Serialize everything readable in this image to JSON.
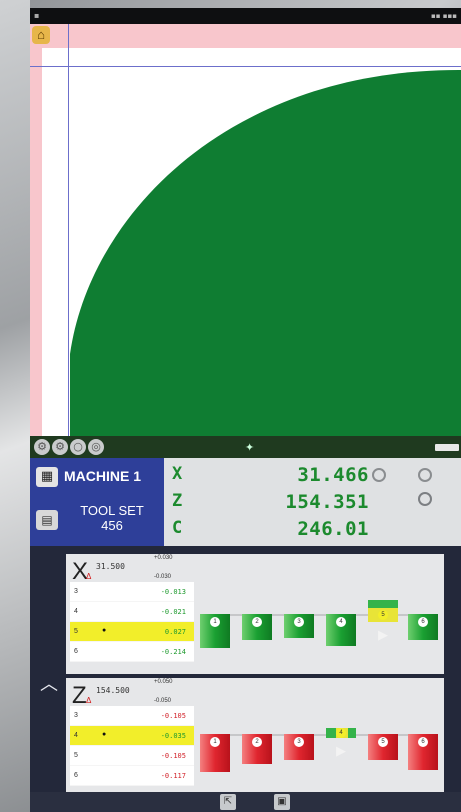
{
  "colors": {
    "canvas_margin": "#f8c6cc",
    "part_fill": "#0f7d32",
    "readout_green": "#1c8a2e",
    "panel_blue": "#2e3f99",
    "highlight_yellow": "#f2ee2a",
    "ok_green": "#1aa032",
    "nok_red": "#e0262f"
  },
  "machine": {
    "name": "MACHINE 1",
    "tool_set_label": "TOOL SET",
    "tool_set_number": "456"
  },
  "axes": [
    {
      "label": "X",
      "value": "31.466"
    },
    {
      "label": "Z",
      "value": "154.351"
    },
    {
      "label": "C",
      "value": "246.01"
    }
  ],
  "x_card": {
    "axis": "X",
    "delta": "Δ",
    "nominal": "31.500",
    "tol_upper": "+0.030",
    "tol_lower": "-0.030",
    "rows": [
      {
        "idx": "3",
        "mark": "",
        "value": "-0.013",
        "color": "green"
      },
      {
        "idx": "4",
        "mark": "",
        "value": "-0.021",
        "color": "green"
      },
      {
        "idx": "5",
        "mark": "●",
        "value": "0.027",
        "color": "green",
        "highlight": true
      },
      {
        "idx": "6",
        "mark": "",
        "value": "-0.214",
        "color": "green"
      }
    ],
    "bars": [
      "1",
      "2",
      "3",
      "4",
      "5",
      "6"
    ]
  },
  "z_card": {
    "axis": "Z",
    "delta": "Δ",
    "nominal": "154.500",
    "tol_upper": "+0.050",
    "tol_lower": "-0.050",
    "rows": [
      {
        "idx": "3",
        "mark": "",
        "value": "-0.105",
        "color": "red"
      },
      {
        "idx": "4",
        "mark": "●",
        "value": "-0.035",
        "color": "green",
        "highlight": true
      },
      {
        "idx": "5",
        "mark": "",
        "value": "-0.105",
        "color": "red"
      },
      {
        "idx": "6",
        "mark": "",
        "value": "-0.117",
        "color": "red"
      }
    ],
    "bars": [
      "1",
      "2",
      "3",
      "4",
      "5",
      "6"
    ]
  },
  "icons": {
    "home": "home-icon",
    "settings": "gear-icon",
    "expand": "chevron-up-icon",
    "export": "export-icon",
    "save": "save-icon"
  }
}
